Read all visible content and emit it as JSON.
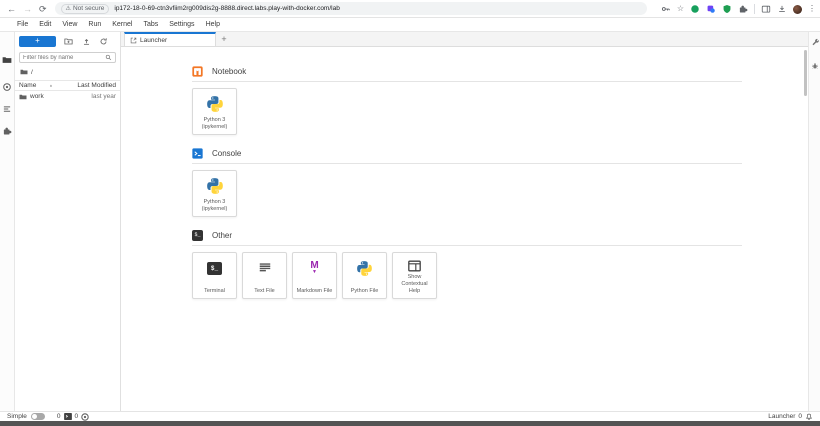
{
  "browser": {
    "back_icon": "←",
    "forward_icon": "→",
    "reload_icon": "⟳",
    "security_warning_icon": "⚠",
    "security_label": "Not secure",
    "url": "ip172-18-0-69-ctn3vfiim2rg009dis2g-8888.direct.labs.play-with-docker.com/lab",
    "bookmark_icon": "☆",
    "menu_icon": "⋮"
  },
  "menubar": {
    "items": [
      "File",
      "Edit",
      "View",
      "Run",
      "Kernel",
      "Tabs",
      "Settings",
      "Help"
    ]
  },
  "filebrowser": {
    "new_launcher_icon": "+",
    "filter_placeholder": "Filter files by name",
    "breadcrumb_root": "/",
    "columns": {
      "name": "Name",
      "sort_icon": "▲",
      "modified": "Last Modified"
    },
    "rows": [
      {
        "name": "work",
        "modified": "last year"
      }
    ]
  },
  "tabbar": {
    "active_tab": "Launcher",
    "new_tab_icon": "+"
  },
  "launcher": {
    "terminal_glyph": "$_",
    "markdown_glyph": "M",
    "markdown_arrow_glyph": "▼",
    "sections": [
      {
        "title": "Notebook",
        "cards": [
          {
            "label": "Python 3\n(ipykernel)"
          }
        ]
      },
      {
        "title": "Console",
        "cards": [
          {
            "label": "Python 3\n(ipykernel)"
          }
        ]
      },
      {
        "title": "Other",
        "cards": [
          {
            "label": "Terminal"
          },
          {
            "label": "Text File"
          },
          {
            "label": "Markdown File"
          },
          {
            "label": "Python File"
          },
          {
            "label": "Show Contextual\nHelp"
          }
        ]
      }
    ]
  },
  "statusbar": {
    "mode_label": "Simple",
    "terminals_count": "0",
    "kernels_count": "0",
    "context_label": "Launcher",
    "notifications_count": "0"
  },
  "colors": {
    "accent_blue": "#1976d2",
    "jupyter_orange": "#f37626",
    "markdown_purple": "#9c27b0",
    "python_blue": "#3372a7",
    "python_yellow": "#ffd43b",
    "terminal_dark": "#333333",
    "shield_green": "#1e9e52",
    "ext_green": "#17a05d",
    "ext_purple": "#6f42f5"
  }
}
